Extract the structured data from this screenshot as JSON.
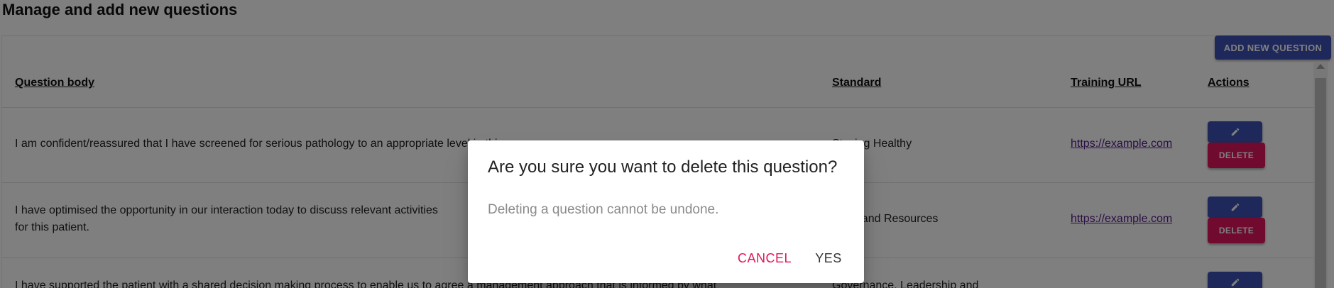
{
  "page": {
    "title": "Manage and add new questions"
  },
  "toolbar": {
    "add_label": "ADD NEW QUESTION"
  },
  "table": {
    "headers": {
      "body": "Question body",
      "standard": "Standard",
      "url": "Training URL",
      "actions": "Actions"
    },
    "rows": [
      {
        "body_line1": "I am confident/reassured that I have screened for serious pathology to an appropriate level in this",
        "body_line2": "",
        "standard": "Staying Healthy",
        "url": "https://example.com",
        "delete_label": "DELETE"
      },
      {
        "body_line1": "I have optimised the opportunity in our interaction today to discuss relevant activities",
        "body_line2": "for this patient.",
        "standard": "Tools and Resources",
        "url": "https://example.com",
        "delete_label": "DELETE"
      },
      {
        "body_line1": "I have supported the patient with a shared decision making process to enable us to agree a management approach that is informed by what",
        "body_line2": "",
        "standard": "Governance, Leadership and",
        "url": "",
        "delete_label": ""
      }
    ]
  },
  "dialog": {
    "title": "Are you sure you want to delete this question?",
    "text": "Deleting a question cannot be undone.",
    "cancel_label": "CANCEL",
    "yes_label": "YES"
  },
  "colors": {
    "primary": "#3f51b5",
    "danger": "#e0155c",
    "link": "#551a8b",
    "overlay": "rgba(0,0,0,0.5)"
  },
  "icons": {
    "edit": "pencil-icon",
    "scroll_up": "chevron-up-icon"
  }
}
